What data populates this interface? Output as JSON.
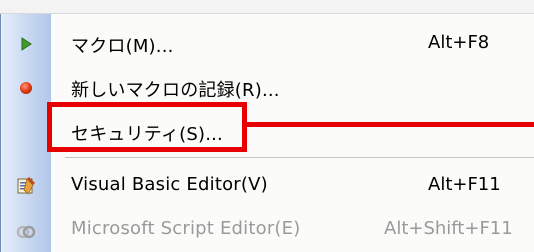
{
  "menu": {
    "items": [
      {
        "label": "マクロ(M)...",
        "shortcut": "Alt+F8",
        "icon": "play-icon",
        "enabled": true
      },
      {
        "label": "新しいマクロの記録(R)...",
        "shortcut": "",
        "icon": "record-icon",
        "enabled": true
      },
      {
        "label": "セキュリティ(S)...",
        "shortcut": "",
        "icon": "",
        "enabled": true
      },
      {
        "label": "Visual Basic Editor(V)",
        "shortcut": "Alt+F11",
        "icon": "vba-editor-icon",
        "enabled": true
      },
      {
        "label": "Microsoft Script Editor(E)",
        "shortcut": "Alt+Shift+F11",
        "icon": "script-editor-icon",
        "enabled": false
      }
    ]
  },
  "colors": {
    "highlight": "#e60000",
    "icon_strip": "#c6d6f0",
    "disabled_text": "#9a9a9a"
  }
}
